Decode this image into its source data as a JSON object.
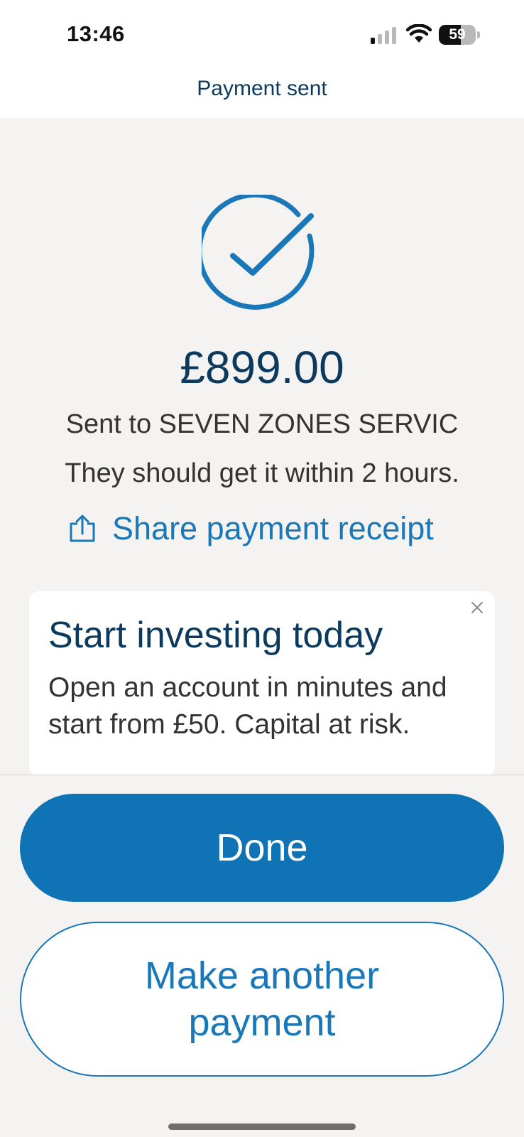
{
  "status_bar": {
    "time": "13:46",
    "battery_level": "59",
    "icons": [
      "signal-icon",
      "wifi-icon",
      "battery-icon"
    ]
  },
  "header": {
    "title": "Payment sent"
  },
  "confirmation": {
    "icon": "checkmark-circle-icon",
    "amount": "£899.00",
    "recipient_text": "Sent to SEVEN ZONES SERVIC",
    "eta_text": "They should get it within 2 hours.",
    "share_label": "Share payment receipt",
    "share_icon": "share-icon"
  },
  "promo": {
    "title": "Start investing today",
    "body": "Open an account in minutes and start from £50. Capital at risk.",
    "close_icon": "close-icon"
  },
  "actions": {
    "done_label": "Done",
    "another_label": "Make another payment"
  },
  "colors": {
    "accent": "#0f73b5",
    "link": "#1a78b8",
    "heading": "#0c3a5e",
    "background": "#f4f3f2"
  }
}
